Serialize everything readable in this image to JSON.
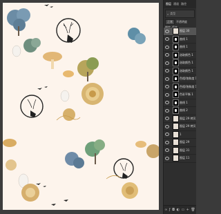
{
  "panel": {
    "tabs": [
      "图层",
      "通道",
      "路径"
    ],
    "filter_label": "类型",
    "blend_mode": "正常",
    "opacity_label": "不透明度",
    "lock_label": "锁定",
    "fill_label": "填充",
    "layers": [
      {
        "name": "图层 30",
        "kind": "thumb",
        "selected": true
      },
      {
        "name": "曲线 1",
        "kind": "mask"
      },
      {
        "name": "曲线 1",
        "kind": "mask"
      },
      {
        "name": "选取颜色 1",
        "kind": "mask"
      },
      {
        "name": "选取颜色 1",
        "kind": "mask"
      },
      {
        "name": "选取颜色 1",
        "kind": "mask"
      },
      {
        "name": "色相/饱和度 1",
        "kind": "mask"
      },
      {
        "name": "色相/饱和度 1",
        "kind": "mask"
      },
      {
        "name": "色彩平衡 1",
        "kind": "mask"
      },
      {
        "name": "曲线 1",
        "kind": "mask"
      },
      {
        "name": "曲线 2",
        "kind": "mask"
      },
      {
        "name": "图层 29 拷贝 4",
        "kind": "thumb"
      },
      {
        "name": "图层 29 拷贝 3",
        "kind": "thumb"
      },
      {
        "name": "1",
        "kind": "thumb"
      },
      {
        "name": "图层 29",
        "kind": "thumb"
      },
      {
        "name": "图层 31",
        "kind": "thumb"
      },
      {
        "name": "图层 11",
        "kind": "thumb"
      }
    ],
    "bottom_icons": [
      "link-icon",
      "fx-icon",
      "mask-icon",
      "adjustment-icon",
      "folder-icon",
      "new-layer-icon",
      "trash-icon"
    ]
  }
}
